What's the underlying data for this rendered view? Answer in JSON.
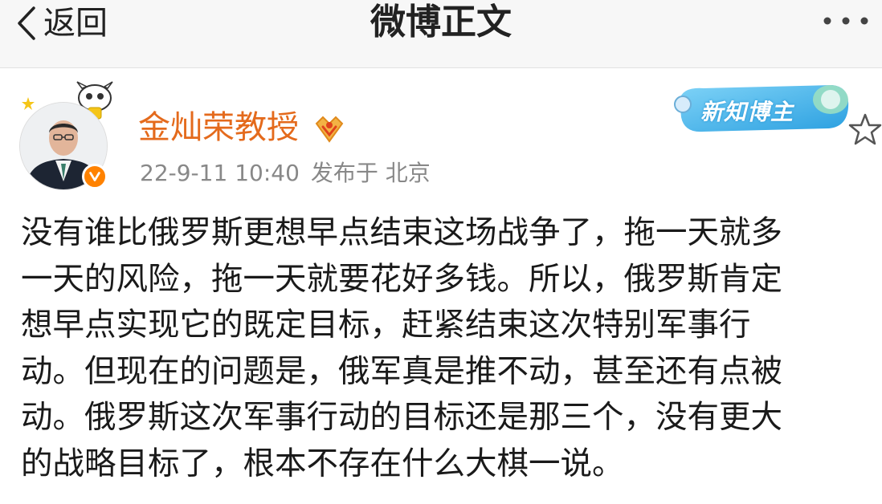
{
  "nav": {
    "back_label": "返回",
    "title": "微博正文",
    "more_icon": "more-dots-icon"
  },
  "author": {
    "name": "金灿荣教授",
    "verified_icon": "verified-v-icon",
    "rank_icon": "rank-medal-icon",
    "badge_label": "新知博主"
  },
  "meta": {
    "date": "22-9-11",
    "time": "10:40",
    "published_at": "发布于 北京"
  },
  "post": {
    "lines": [
      "没有谁比俄罗斯更想早点结束这场战争了，拖一天就多",
      "一天的风险，拖一天就要花好多钱。所以，俄罗斯肯定",
      "想早点实现它的既定目标，赶紧结束这次特别军事行",
      "动。但现在的问题是，俄军真是推不动，甚至还有点被",
      "动。俄罗斯这次军事行动的目标还是那三个，没有更大",
      "的战略目标了，根本不存在什么大棋一说。"
    ]
  },
  "colors": {
    "username": "#e46a1c",
    "verified": "#ff8200",
    "meta_text": "#888888",
    "nav_bg": "#f7f7f7",
    "badge": "#3db2ee"
  }
}
